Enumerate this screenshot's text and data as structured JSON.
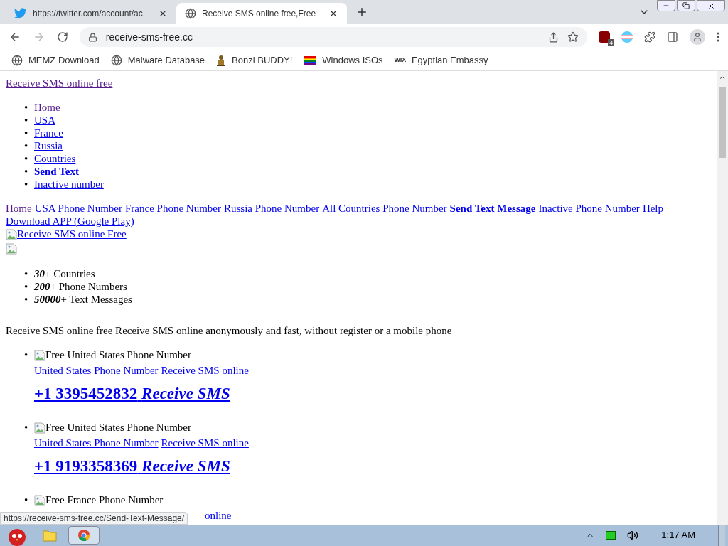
{
  "tabs": [
    {
      "title": "https://twitter.com/account/ac",
      "selected": false
    },
    {
      "title": "Receive SMS online free,Free",
      "selected": true
    }
  ],
  "address_bar": {
    "url": "receive-sms-free.cc"
  },
  "extension_badge": "4",
  "bookmarks": [
    {
      "label": "MEMZ Download"
    },
    {
      "label": "Malware Database"
    },
    {
      "label": "Bonzi BUDDY!"
    },
    {
      "label": "Windows ISOs"
    },
    {
      "label": "Egyptian Embassy",
      "icon_text": "WIX"
    }
  ],
  "page": {
    "bullet": "•",
    "site_title": {
      "text": "Receive SMS online free",
      "visited": true
    },
    "nav_list": [
      {
        "text": "Home",
        "visited": true,
        "bold": false
      },
      {
        "text": "USA",
        "visited": false,
        "bold": false
      },
      {
        "text": "France",
        "visited": false,
        "bold": false
      },
      {
        "text": "Russia",
        "visited": false,
        "bold": false
      },
      {
        "text": "Countries",
        "visited": false,
        "bold": false
      },
      {
        "text": "Send Text",
        "visited": false,
        "bold": true
      },
      {
        "text": "Inactive number",
        "visited": false,
        "bold": false
      }
    ],
    "nav_links": [
      {
        "text": "Home",
        "visited": true,
        "bold": false
      },
      {
        "text": "USA Phone Number",
        "visited": false,
        "bold": false
      },
      {
        "text": "France Phone Number",
        "visited": false,
        "bold": false
      },
      {
        "text": "Russia Phone Number",
        "visited": false,
        "bold": false
      },
      {
        "text": "All Countries Phone Number",
        "visited": false,
        "bold": false
      },
      {
        "text": "Send Text Message",
        "visited": false,
        "bold": true
      },
      {
        "text": "Inactive Phone Number",
        "visited": false,
        "bold": false
      },
      {
        "text": "Help",
        "visited": false,
        "bold": false
      },
      {
        "text": "Download APP (Google Play)",
        "visited": false,
        "bold": false
      }
    ],
    "logo_alt": "Receive SMS online Free",
    "stats": [
      {
        "number": "30",
        "label": "+ Countries"
      },
      {
        "number": "200",
        "label": "+ Phone Numbers"
      },
      {
        "number": "50000",
        "label": "+ Text Messages"
      }
    ],
    "intro": "Receive SMS online free Receive SMS online anonymously and fast, without register or a mobile phone",
    "numbers": [
      {
        "kind": "full",
        "image_alt": "Free United States Phone Number",
        "links": [
          "United States Phone Number",
          "Receive SMS online"
        ],
        "number": "+1 3395452832",
        "action": "Receive SMS"
      },
      {
        "kind": "full",
        "image_alt": "Free United States Phone Number",
        "links": [
          "United States Phone Number",
          "Receive SMS online"
        ],
        "number": "+1 9193358369",
        "action": "Receive SMS"
      },
      {
        "kind": "partial",
        "image_alt": "Free France Phone Number",
        "links": [
          "online"
        ]
      }
    ]
  },
  "status_url": "https://receive-sms-free.cc/Send-Text-Message/",
  "taskbar": {
    "clock": "1:17 AM"
  }
}
